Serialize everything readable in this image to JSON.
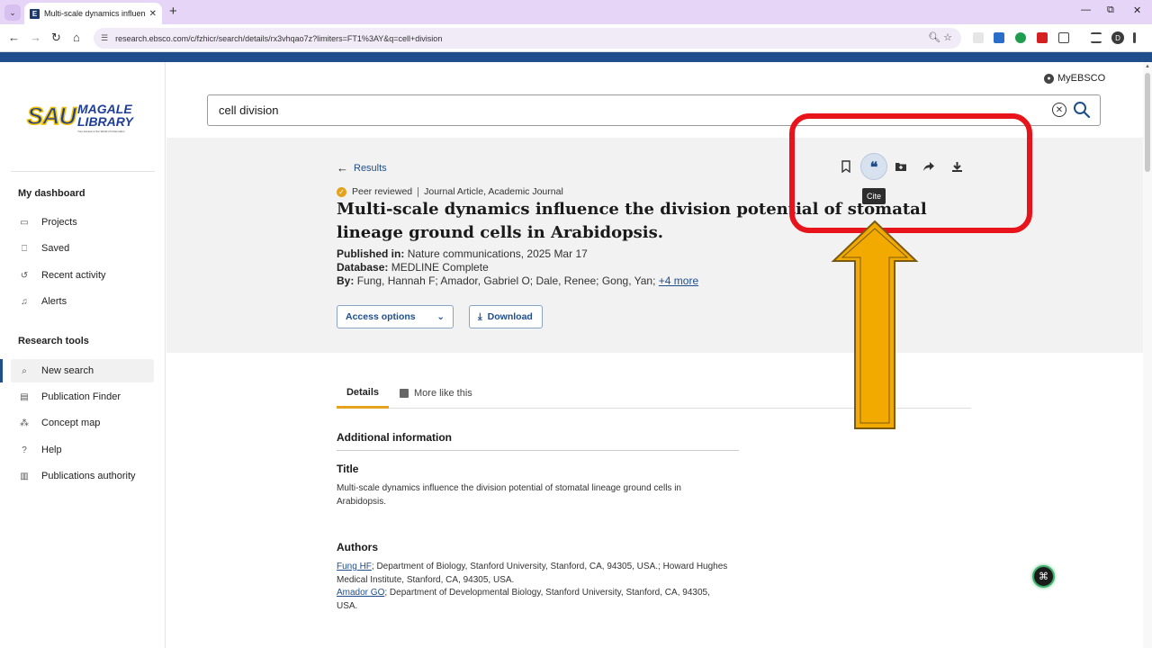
{
  "browser": {
    "tab_title": "Multi-scale dynamics influence",
    "url": "research.ebsco.com/c/fzhicr/search/details/rx3vhqao7z?limiters=FT1%3AY&q=cell+division",
    "profile_initial": "D"
  },
  "sidebar": {
    "logo_sau": "SAU",
    "logo_line1": "MAGALE",
    "logo_line2": "LIBRARY",
    "logo_tagline": "Your Access to the World of Information",
    "dashboard_heading": "My dashboard",
    "dashboard_items": [
      {
        "label": "Projects",
        "icon": "projects-icon"
      },
      {
        "label": "Saved",
        "icon": "bookmark-icon"
      },
      {
        "label": "Recent activity",
        "icon": "history-icon"
      },
      {
        "label": "Alerts",
        "icon": "bell-icon"
      }
    ],
    "tools_heading": "Research tools",
    "tools_items": [
      {
        "label": "New search",
        "icon": "search-icon"
      },
      {
        "label": "Publication Finder",
        "icon": "document-icon"
      },
      {
        "label": "Concept map",
        "icon": "concept-map-icon"
      },
      {
        "label": "Help",
        "icon": "help-icon"
      },
      {
        "label": "Publications authority",
        "icon": "book-icon"
      }
    ]
  },
  "header": {
    "account_label": "MyEBSCO"
  },
  "search": {
    "value": "cell division"
  },
  "article": {
    "back_label": "Results",
    "peer_reviewed": "Peer reviewed",
    "doc_type": "Journal Article, Academic Journal",
    "title": "Multi-scale dynamics influence the division potential of stomatal lineage ground cells in Arabidopsis.",
    "published_label": "Published in:",
    "published_value": "Nature communications, 2025 Mar 17",
    "database_label": "Database:",
    "database_value": "MEDLINE Complete",
    "by_label": "By:",
    "by_value": "Fung, Hannah F; Amador, Gabriel O; Dale, Renee; Gong, Yan;",
    "more_authors": "+4 more",
    "access_button": "Access options",
    "download_button": "Download",
    "tooltip": "Cite"
  },
  "tabs": {
    "details": "Details",
    "more_like_this": "More like this"
  },
  "details": {
    "additional_heading": "Additional information",
    "title_heading": "Title",
    "title_text": "Multi-scale dynamics influence the division potential of stomatal lineage ground cells in Arabidopsis.",
    "authors_heading": "Authors",
    "author1_name": "Fung HF",
    "author1_affil": "; Department of Biology, Stanford University, Stanford, CA, 94305, USA.; Howard Hughes Medical Institute, Stanford, CA, 94305, USA.",
    "author2_name": "Amador GO",
    "author2_affil": "; Department of Developmental Biology, Stanford University, Stanford, CA, 94305, USA."
  },
  "colors": {
    "brand_blue": "#1f4e8c",
    "highlight_red": "#e8141b",
    "arrow_orange": "#f2a900",
    "peer_badge": "#e4a21f"
  }
}
